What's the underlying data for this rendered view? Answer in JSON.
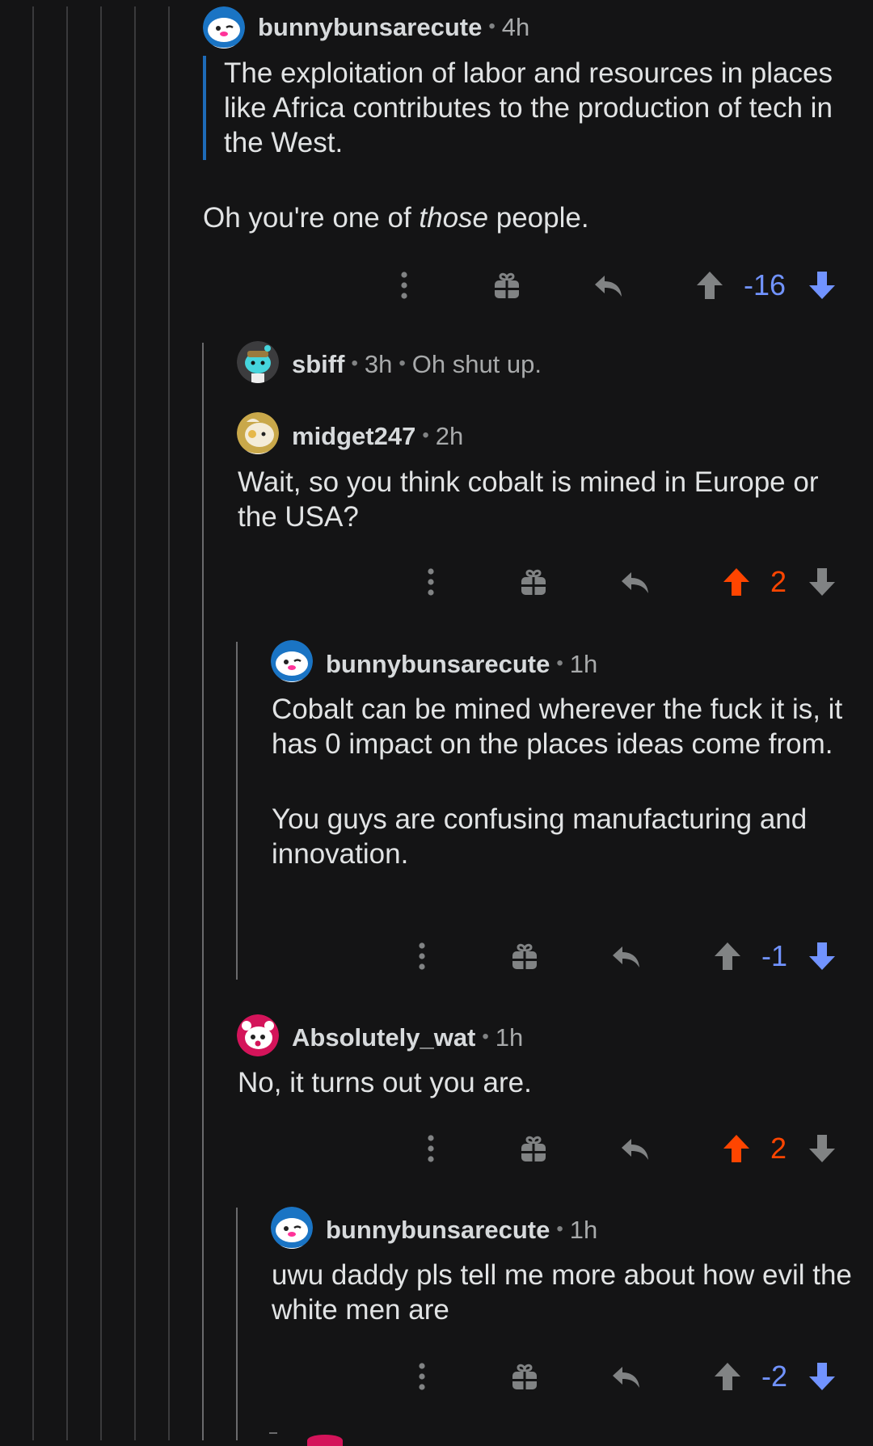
{
  "comments": [
    {
      "author": "bunnybunsarecute",
      "time": "4h",
      "quote": "The exploitation of labor and resources in places like Africa contributes to the production of tech in the West.",
      "body_before": "Oh you're one of ",
      "body_em": "those",
      "body_after": " people.",
      "score": "-16",
      "vote_state": "downvoted"
    },
    {
      "author": "sbiff",
      "time": "3h",
      "collapsed_text": "Oh shut up."
    },
    {
      "author": "midget247",
      "time": "2h",
      "body": "Wait, so you think cobalt is mined in Europe or the USA?",
      "score": "2",
      "vote_state": "upvoted"
    },
    {
      "author": "bunnybunsarecute",
      "time": "1h",
      "body_p1": "Cobalt can be mined wherever the fuck it is, it has 0 impact on the places ideas come from.",
      "body_p2": "You guys are confusing manufacturing and innovation.",
      "score": "-1",
      "vote_state": "downvoted"
    },
    {
      "author": "Absolutely_wat",
      "time": "1h",
      "body": "No, it turns out you are.",
      "score": "2",
      "vote_state": "upvoted"
    },
    {
      "author": "bunnybunsarecute",
      "time": "1h",
      "body": "uwu daddy pls tell me more about how evil the white men are",
      "score": "-2",
      "vote_state": "downvoted"
    }
  ],
  "colors": {
    "background": "#141415",
    "upvote": "#ff4500",
    "downvote": "#7193ff",
    "neutral_icon": "#818384",
    "quote_bar": "#1e6bb8"
  },
  "icons": [
    "more-icon",
    "gift-icon",
    "reply-icon",
    "upvote-arrow-icon",
    "downvote-arrow-icon"
  ]
}
